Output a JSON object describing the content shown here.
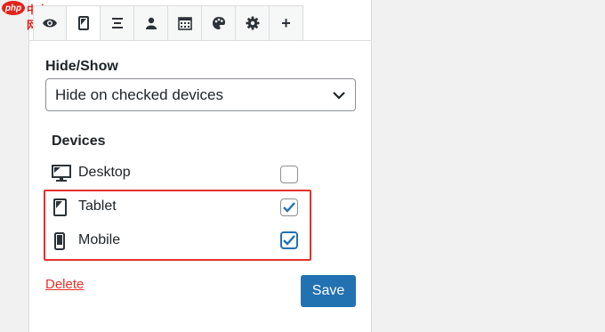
{
  "watermark": {
    "brand": "php",
    "site": "中文网"
  },
  "tabs": [
    {
      "icon": "eye-icon",
      "active": false
    },
    {
      "icon": "tablet-icon",
      "active": true
    },
    {
      "icon": "align-center-icon",
      "active": false
    },
    {
      "icon": "user-icon",
      "active": false
    },
    {
      "icon": "calendar-icon",
      "active": false
    },
    {
      "icon": "palette-icon",
      "active": false
    },
    {
      "icon": "gear-icon",
      "active": false
    },
    {
      "icon": "plus-icon",
      "label": "+",
      "active": false
    }
  ],
  "hide_show": {
    "label": "Hide/Show",
    "selected": "Hide on checked devices"
  },
  "devices": {
    "title": "Devices",
    "items": [
      {
        "label": "Desktop",
        "icon": "desktop-icon",
        "checked": false
      },
      {
        "label": "Tablet",
        "icon": "tablet-icon",
        "checked": true
      },
      {
        "label": "Mobile",
        "icon": "mobile-icon",
        "checked": true
      }
    ]
  },
  "actions": {
    "delete_label": "Delete",
    "save_label": "Save"
  },
  "colors": {
    "accent": "#2271b1",
    "highlight": "#e3322b",
    "check": "#2271b1"
  }
}
